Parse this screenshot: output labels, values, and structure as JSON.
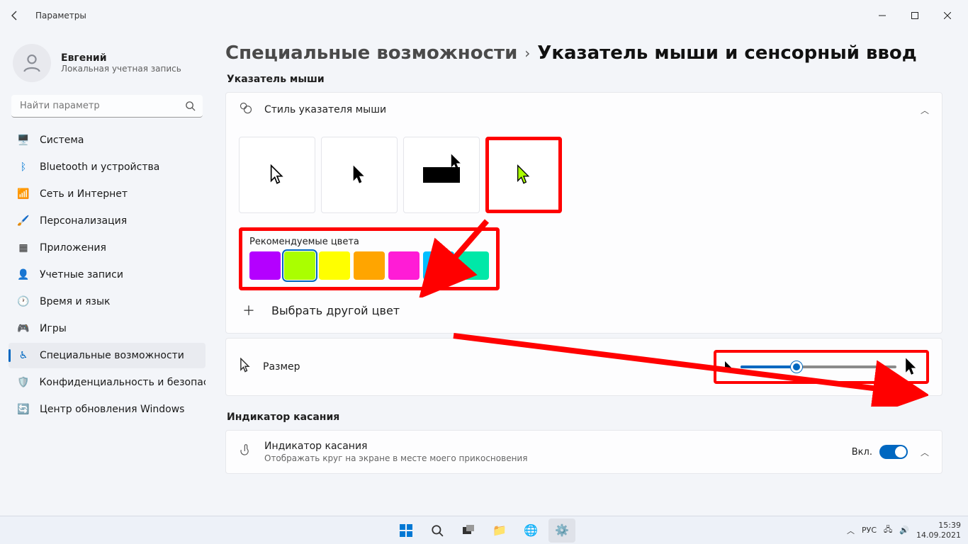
{
  "titlebar": {
    "title": "Параметры"
  },
  "user": {
    "name": "Евгений",
    "sub": "Локальная учетная запись"
  },
  "search": {
    "placeholder": "Найти параметр"
  },
  "nav": {
    "system": "Система",
    "bluetooth": "Bluetooth и устройства",
    "network": "Сеть и Интернет",
    "personalization": "Персонализация",
    "apps": "Приложения",
    "accounts": "Учетные записи",
    "time": "Время и язык",
    "games": "Игры",
    "accessibility": "Специальные возможности",
    "privacy": "Конфиденциальность и безопас",
    "update": "Центр обновления Windows"
  },
  "breadcrumb": {
    "parent": "Специальные возможности",
    "current": "Указатель мыши и сенсорный ввод"
  },
  "sections": {
    "pointer": "Указатель мыши",
    "touch": "Индикатор касания"
  },
  "style": {
    "title": "Стиль указателя мыши",
    "options": [
      "white",
      "black",
      "inverted",
      "custom"
    ],
    "selected": "custom"
  },
  "colors": {
    "label": "Рекомендуемые цвета",
    "items": [
      "#b400ff",
      "#aaff00",
      "#ffff00",
      "#ffa500",
      "#ff1cd6",
      "#00bfff",
      "#00e8a8"
    ],
    "selected_index": 1,
    "pick_other": "Выбрать другой цвет"
  },
  "size": {
    "label": "Размер",
    "value_percent": 36
  },
  "touch_indicator": {
    "title": "Индикатор касания",
    "sub": "Отображать круг на экране в месте моего прикосновения",
    "state_label": "Вкл.",
    "on": true
  },
  "taskbar": {
    "lang": "РУС",
    "time": "15:39",
    "date": "14.09.2021"
  },
  "annotations": {
    "highlight_color": "#ff0000"
  }
}
